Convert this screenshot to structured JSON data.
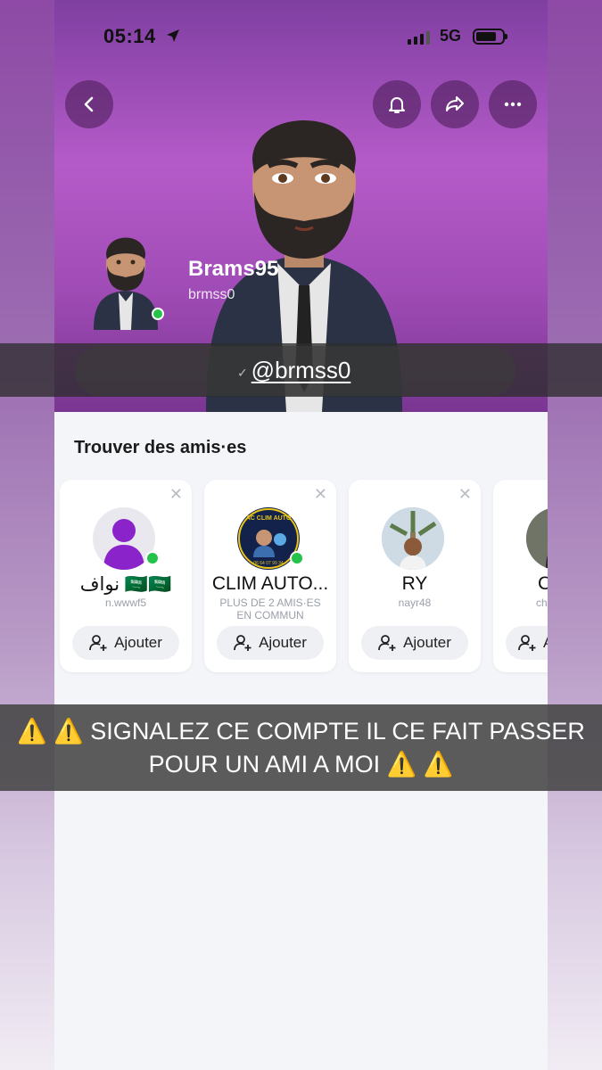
{
  "status_bar": {
    "time": "05:14",
    "network": "5G"
  },
  "profile": {
    "display_name": "Brams95",
    "username": "brmss0",
    "handle_text": "@brmss0"
  },
  "friends_section": {
    "title": "Trouver des amis·es",
    "cards": [
      {
        "name": "نواف 🇸🇦🇸🇦",
        "sub": "n.wwwf5",
        "add_label": "Ajouter",
        "online": true
      },
      {
        "name": "CLIM AUTO...",
        "sub": "PLUS DE 2 AMIS·ES EN COMMUN",
        "add_label": "Ajouter",
        "online": true,
        "badge_top": "AC CLIM AUTO",
        "badge_phone": "06 64 07 99 34"
      },
      {
        "name": "RY",
        "sub": "nayr48",
        "add_label": "Ajouter",
        "online": false
      },
      {
        "name": "C",
        "sub": "ch",
        "add_label": "A",
        "online": false
      }
    ]
  },
  "overlay": {
    "warning": "⚠️ ⚠️  SIGNALEZ CE COMPTE IL CE FAIT PASSER POUR UN AMI A MOI ⚠️ ⚠️"
  },
  "colors": {
    "hero_purple": "#b55bc9",
    "online_green": "#26c34a"
  },
  "icons": [
    "back-chevron-icon",
    "bell-icon",
    "share-icon",
    "more-dots-icon",
    "add-friend-icon",
    "close-icon",
    "location-arrow-icon"
  ]
}
